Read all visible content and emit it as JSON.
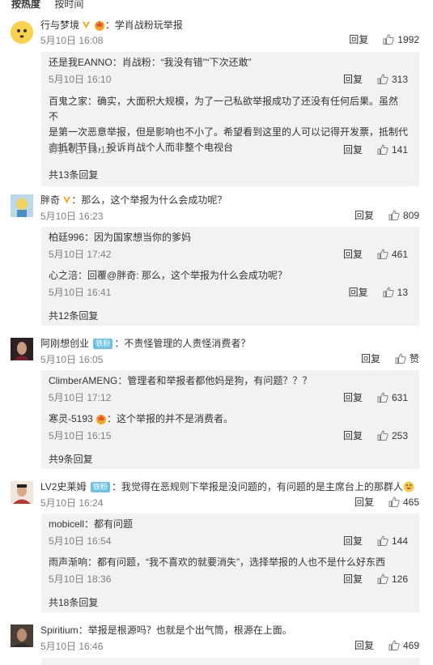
{
  "sort": {
    "hot": "按热度",
    "time": "按时间"
  },
  "reply_label": "回复",
  "comments": [
    {
      "user": "行与梦境",
      "text": "：学肖战粉玩举报",
      "date": "5月10日 16:08",
      "likes": "1992",
      "subs": [
        {
          "user": "还是我EANNO",
          "text": "：肖战粉：“我没有错”“下次还敢”",
          "date": "5月10日 16:10",
          "likes": "313"
        },
        {
          "user": "百鬼之家",
          "text_lines": [
            "：确实，大面积大规模，为了一己私欲举报成功了还没有任何后果。虽然不",
            "是第一次恶意举报，但是影响也不小了。希望看到这里的人可以记得开发票，抵制代",
            "言抵制节目，投诉肖战个人而非整个电视台"
          ],
          "date": "5月10日 18:12",
          "likes": "141"
        }
      ],
      "more": "共13条回复"
    },
    {
      "user": "胖奇",
      "text": "：那么，这个举报为什么会成功呢？",
      "date": "5月10日 16:23",
      "likes": "809",
      "subs": [
        {
          "user": "柏廷996",
          "text": "：因为国家想当你的爹妈",
          "date": "5月10日 17:42",
          "likes": "461"
        },
        {
          "user": "心之涪",
          "text": "：回覆@胖奇: 那么，这个举报为什么会成功呢？",
          "date": "5月10日 16:41",
          "likes": "13"
        }
      ],
      "more": "共12条回复"
    },
    {
      "user": "阿刚想创业",
      "badge": "铁粉",
      "text": "：不责怪管理的人责怪消费者？",
      "date": "5月10日 16:05",
      "likes": "赞",
      "subs": [
        {
          "user": "ClimberAMENG",
          "text": "：管理者和举报者都他妈是狗，有问题？？？",
          "date": "5月10日 17:12",
          "likes": "631"
        },
        {
          "user": "寒灵-5193",
          "text": "：这个举报的并不是消费者。",
          "date": "5月10日 16:15",
          "likes": "253"
        }
      ],
      "more": "共9条回复"
    },
    {
      "user": "LV2史莱姆",
      "badge": "铁粉",
      "text": "：我觉得在恶规则下举报是没问题的，有问题的是主席台上的那群人",
      "date": "5月10日 16:24",
      "likes": "465",
      "subs": [
        {
          "user": "mobicell",
          "text": "：都有问题",
          "date": "5月10日 16:54",
          "likes": "144"
        },
        {
          "user": "雨声渐响",
          "text": "：都有问题，“我不喜欢的就要消失”，选择举报的人也不是什么好东西",
          "date": "5月10日 18:36",
          "likes": "126"
        }
      ],
      "more": "共18条回复"
    },
    {
      "user": "Spiritium",
      "text": "：举报是根源吗？也就是个出气筒，根源在上面。",
      "date": "5月10日 16:46",
      "likes": "469"
    }
  ]
}
